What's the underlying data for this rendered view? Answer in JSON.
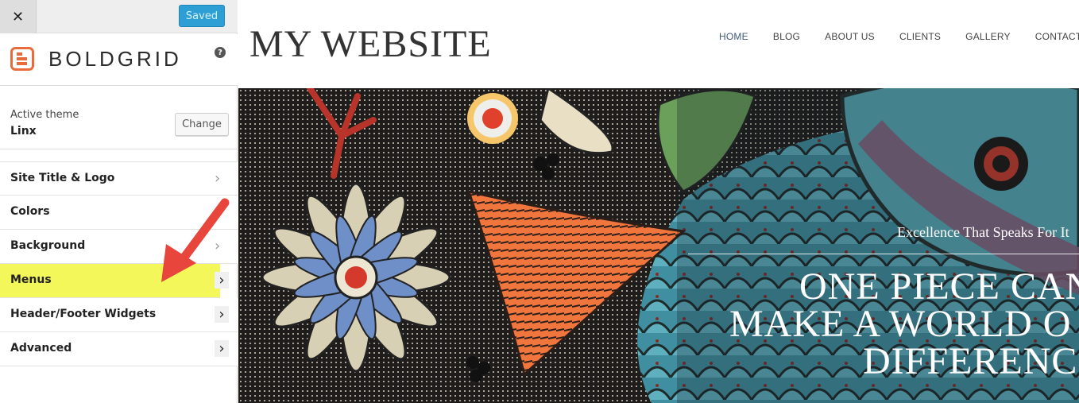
{
  "sidebar": {
    "close_symbol": "✕",
    "saved_label": "Saved",
    "brand": {
      "name": "BOLDGRID",
      "logo_icon": "boldgrid-logo-icon",
      "accent": "#e96b3c"
    },
    "help_symbol": "?",
    "theme": {
      "label": "Active theme",
      "name": "Linx",
      "change_label": "Change"
    },
    "items": [
      {
        "label": "Site Title & Logo",
        "chevron": "›"
      },
      {
        "label": "Colors"
      },
      {
        "label": "Background",
        "chevron": "›"
      },
      {
        "label": "Menus",
        "chevron": "›",
        "highlight_color": "#f4f75a"
      },
      {
        "label": "Header/Footer Widgets",
        "chevron": "›"
      },
      {
        "label": "Advanced",
        "chevron": "›"
      }
    ],
    "annotation": {
      "icon": "red-arrow-icon",
      "color": "#e8453c"
    }
  },
  "preview": {
    "site_title": "MY WEBSITE",
    "nav": [
      "HOME",
      "BLOG",
      "ABOUT US",
      "CLIENTS",
      "GALLERY",
      "CONTACT US"
    ],
    "hero": {
      "tagline": "Excellence That Speaks For It",
      "heading_lines": [
        "ONE PIECE CAN",
        "MAKE A WORLD O",
        "DIFFERENC"
      ]
    }
  },
  "colors": {
    "saved_button": "#2e9fd4",
    "active_nav": "#3f5a7c"
  }
}
